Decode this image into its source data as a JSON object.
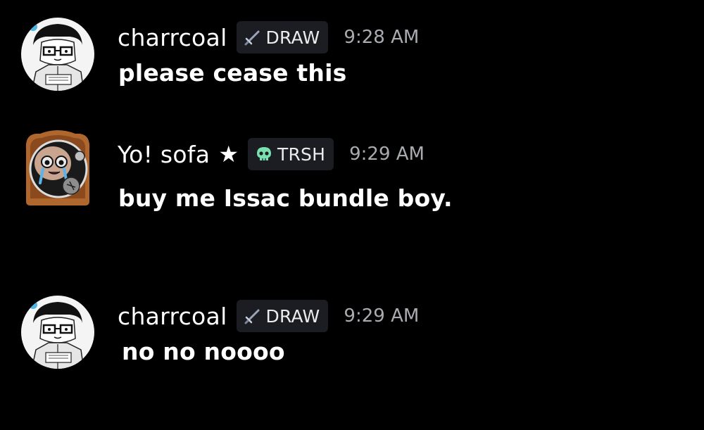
{
  "colors": {
    "background": "#000000",
    "username": "#ffffff",
    "timestamp": "#a9abb0",
    "tag_background": "#1c1d22",
    "tag_text": "#ececec",
    "trsh_skull": "#7be0b0",
    "draw_sword": "#9aa3b8"
  },
  "messages": [
    {
      "avatar_icon": "sketch-character-avatar-icon",
      "username": "charrcoal",
      "star": "",
      "tag": {
        "icon": "sword-icon",
        "label": "DRAW"
      },
      "timestamp": "9:28 AM",
      "content": "please cease this"
    },
    {
      "avatar_icon": "isaac-toast-avatar-icon",
      "username": "Yo! sofa",
      "star": "★",
      "tag": {
        "icon": "skull-icon",
        "label": "TRSH"
      },
      "timestamp": "9:29 AM",
      "content": "buy me Issac bundle boy."
    },
    {
      "avatar_icon": "sketch-character-avatar-icon",
      "username": "charrcoal",
      "star": "",
      "tag": {
        "icon": "sword-icon",
        "label": "DRAW"
      },
      "timestamp": "9:29 AM",
      "content": "no no noooo"
    }
  ]
}
